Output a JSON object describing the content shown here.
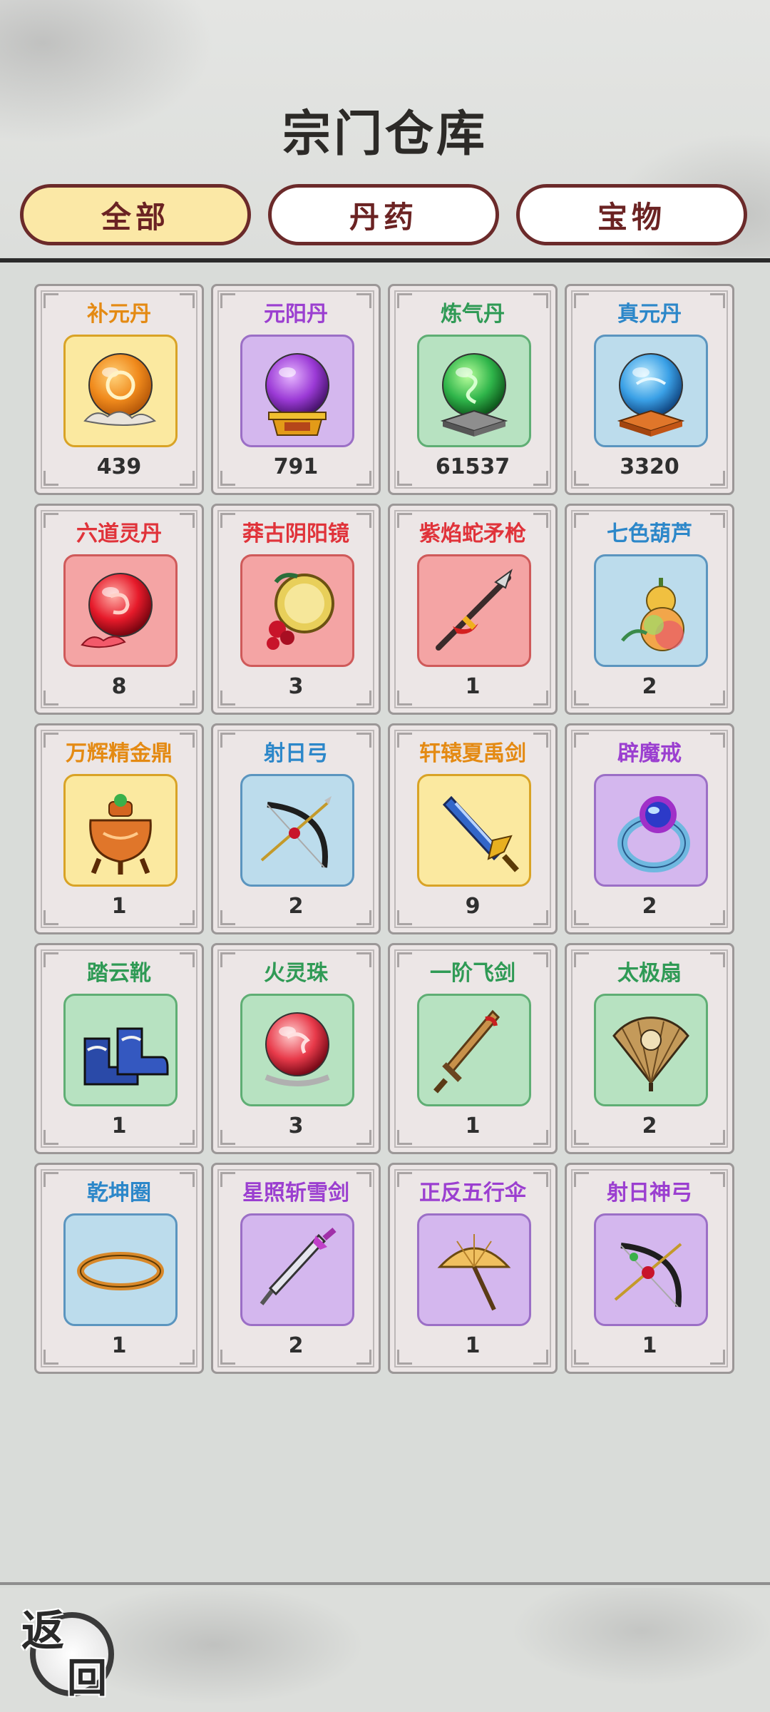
{
  "header": {
    "title": "宗门仓库",
    "tabs": [
      {
        "label": "全部",
        "active": true
      },
      {
        "label": "丹药",
        "active": false
      },
      {
        "label": "宝物",
        "active": false
      }
    ]
  },
  "items": [
    {
      "name": "补元丹",
      "count": "439",
      "name_color": "#e48a13",
      "frame_bg": "#fbe9a0",
      "frame_border": "#d9a326",
      "icon": "orange-pill-icon"
    },
    {
      "name": "元阳丹",
      "count": "791",
      "name_color": "#9b3fd0",
      "frame_bg": "#d4b7ee",
      "frame_border": "#9b6fc6",
      "icon": "purple-orb-icon"
    },
    {
      "name": "炼气丹",
      "count": "61537",
      "name_color": "#2f9a55",
      "frame_bg": "#b7e2c1",
      "frame_border": "#5fae74",
      "icon": "green-orb-icon"
    },
    {
      "name": "真元丹",
      "count": "3320",
      "name_color": "#2c87c9",
      "frame_bg": "#bcdcec",
      "frame_border": "#5b95bf",
      "icon": "blue-orb-icon"
    },
    {
      "name": "六道灵丹",
      "count": "8",
      "name_color": "#e0333a",
      "frame_bg": "#f4a4a4",
      "frame_border": "#cf5a5a",
      "icon": "red-pill-icon"
    },
    {
      "name": "莽古阴阳镜",
      "count": "3",
      "name_color": "#e0333a",
      "frame_bg": "#f4a4a4",
      "frame_border": "#cf5a5a",
      "icon": "mirror-icon"
    },
    {
      "name": "紫焰蛇矛枪",
      "count": "1",
      "name_color": "#e0333a",
      "frame_bg": "#f4a4a4",
      "frame_border": "#cf5a5a",
      "icon": "spear-icon"
    },
    {
      "name": "七色葫芦",
      "count": "2",
      "name_color": "#2c87c9",
      "frame_bg": "#bcdcec",
      "frame_border": "#5b95bf",
      "icon": "gourd-icon"
    },
    {
      "name": "万辉精金鼎",
      "count": "1",
      "name_color": "#e48a13",
      "frame_bg": "#fbe9a0",
      "frame_border": "#d9a326",
      "icon": "cauldron-icon"
    },
    {
      "name": "射日弓",
      "count": "2",
      "name_color": "#2c87c9",
      "frame_bg": "#bcdcec",
      "frame_border": "#5b95bf",
      "icon": "bow-icon"
    },
    {
      "name": "轩辕夏禹剑",
      "count": "9",
      "name_color": "#e48a13",
      "frame_bg": "#fbe9a0",
      "frame_border": "#d9a326",
      "icon": "sword-icon"
    },
    {
      "name": "辟魔戒",
      "count": "2",
      "name_color": "#9b3fd0",
      "frame_bg": "#d4b7ee",
      "frame_border": "#9b6fc6",
      "icon": "ring-icon"
    },
    {
      "name": "踏云靴",
      "count": "1",
      "name_color": "#2f9a55",
      "frame_bg": "#b7e2c1",
      "frame_border": "#5fae74",
      "icon": "boots-icon"
    },
    {
      "name": "火灵珠",
      "count": "3",
      "name_color": "#2f9a55",
      "frame_bg": "#b7e2c1",
      "frame_border": "#5fae74",
      "icon": "fire-pearl-icon"
    },
    {
      "name": "一阶飞剑",
      "count": "1",
      "name_color": "#2f9a55",
      "frame_bg": "#b7e2c1",
      "frame_border": "#5fae74",
      "icon": "wooden-sword-icon"
    },
    {
      "name": "太极扇",
      "count": "2",
      "name_color": "#2f9a55",
      "frame_bg": "#b7e2c1",
      "frame_border": "#5fae74",
      "icon": "fan-icon"
    },
    {
      "name": "乾坤圈",
      "count": "1",
      "name_color": "#2c87c9",
      "frame_bg": "#bcdcec",
      "frame_border": "#5b95bf",
      "icon": "golden-ring-icon"
    },
    {
      "name": "星照斩雪剑",
      "count": "2",
      "name_color": "#9b3fd0",
      "frame_bg": "#d4b7ee",
      "frame_border": "#9b6fc6",
      "icon": "star-sword-icon"
    },
    {
      "name": "正反五行伞",
      "count": "1",
      "name_color": "#9b3fd0",
      "frame_bg": "#d4b7ee",
      "frame_border": "#9b6fc6",
      "icon": "umbrella-icon"
    },
    {
      "name": "射日神弓",
      "count": "1",
      "name_color": "#9b3fd0",
      "frame_bg": "#d4b7ee",
      "frame_border": "#9b6fc6",
      "icon": "divine-bow-icon"
    }
  ],
  "footer": {
    "back_label_top": "返",
    "back_label_bottom": "回"
  }
}
